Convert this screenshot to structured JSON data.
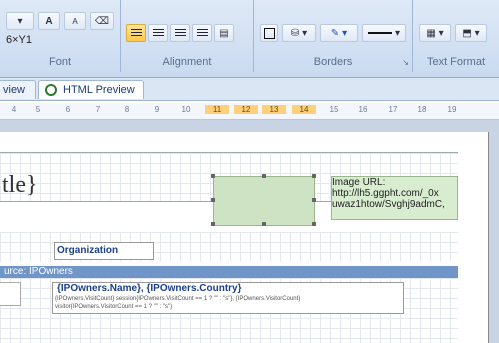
{
  "ribbon": {
    "font_group": {
      "label": "Font",
      "size_text": "6×Y1",
      "grow_label": "A",
      "shrink_label": "A"
    },
    "alignment_group": {
      "label": "Alignment"
    },
    "borders_group": {
      "label": "Borders",
      "launcher": "↘"
    },
    "text_format_group": {
      "label": "Text Format"
    }
  },
  "tabs": [
    {
      "label": "view"
    },
    {
      "label": "HTML Preview"
    }
  ],
  "ruler": {
    "ticks": [
      "4",
      "5",
      "6",
      "7",
      "8",
      "9",
      "10",
      "11",
      "12",
      "13",
      "14",
      "15",
      "16",
      "17",
      "18",
      "19"
    ]
  },
  "report": {
    "title_fragment": "tle}",
    "image_url_text": "Image URL:\nhttp://lh5.ggpht.com/_0x\nuwaz1htow/Svghj9admC,",
    "organization_label": "Organization",
    "datasource_band": "urce: IPOwners",
    "owner_line": "{IPOwners.Name}, {IPOwners.Country}",
    "owner_expr_1": "{IPOwners.VisitCount} session{IPOwners.VisitCount == 1 ? \"\" : \"s\"}, {IPOwners.VisitorCount}",
    "owner_expr_2": "visitor{IPOwners.VisitorCount == 1 ? \"\" : \"s\"}"
  },
  "colors": {
    "ribbon_bg": "#dfe9f7",
    "active_button": "#ffc84a",
    "image_placeholder": "#cde3c3",
    "band": "#6f95c9",
    "field_text": "#1b3f8c"
  }
}
